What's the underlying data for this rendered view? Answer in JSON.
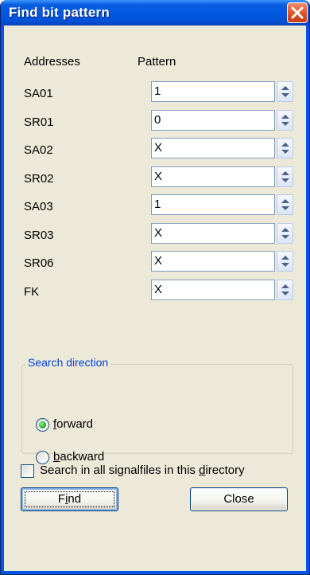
{
  "window": {
    "title": "Find bit pattern"
  },
  "headers": {
    "addresses": "Addresses",
    "pattern": "Pattern"
  },
  "rows": [
    {
      "address": "SA01",
      "pattern": "1"
    },
    {
      "address": "SR01",
      "pattern": "0"
    },
    {
      "address": "SA02",
      "pattern": "X"
    },
    {
      "address": "SR02",
      "pattern": "X"
    },
    {
      "address": "SA03",
      "pattern": "1"
    },
    {
      "address": "SR03",
      "pattern": "X"
    },
    {
      "address": "SR06",
      "pattern": "X"
    },
    {
      "address": "FK",
      "pattern": "X"
    }
  ],
  "search_direction": {
    "title": "Search direction",
    "forward": {
      "mnemonic": "f",
      "rest": "orward",
      "selected": true
    },
    "backward": {
      "mnemonic": "b",
      "rest": "ackward",
      "selected": false
    }
  },
  "all_files_checkbox": {
    "prefix": "Search in all signalfiles in this ",
    "mnemonic": "d",
    "suffix": "irectory",
    "checked": false
  },
  "buttons": {
    "find": {
      "prefix": "F",
      "mnemonic": "i",
      "suffix": "nd"
    },
    "close": {
      "label": "Close"
    }
  },
  "icons": {
    "close": "close-icon",
    "spin_up": "chevron-up-icon",
    "spin_down": "chevron-down-icon"
  }
}
